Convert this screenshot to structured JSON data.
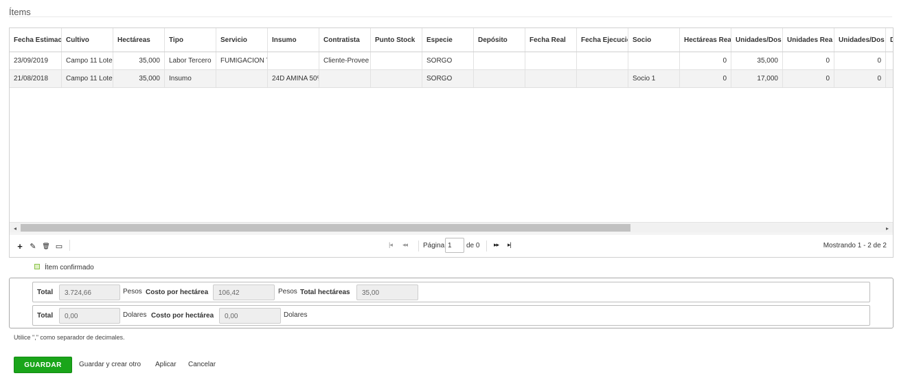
{
  "section": {
    "title": "Ítems"
  },
  "grid": {
    "columns": [
      {
        "label": "Fecha Estimac"
      },
      {
        "label": "Cultivo"
      },
      {
        "label": "Hectáreas"
      },
      {
        "label": "Tipo"
      },
      {
        "label": "Servicio"
      },
      {
        "label": "Insumo"
      },
      {
        "label": "Contratista"
      },
      {
        "label": "Punto Stock"
      },
      {
        "label": "Especie"
      },
      {
        "label": "Depósito"
      },
      {
        "label": "Fecha Real"
      },
      {
        "label": "Fecha Ejecució"
      },
      {
        "label": "Socio"
      },
      {
        "label": "Hectáreas Rea"
      },
      {
        "label": "Unidades/Dos"
      },
      {
        "label": "Unidades Rea"
      },
      {
        "label": "Unidades/Dos"
      },
      {
        "label": "D"
      }
    ],
    "rows": [
      {
        "cells": [
          "23/09/2019",
          "Campo 11 Lote",
          "35,000",
          "Labor Tercero",
          "FUMIGACION T",
          "",
          "Cliente-Provee",
          "",
          "SORGO",
          "",
          "",
          "",
          "",
          "0",
          "35,000",
          "0",
          "0",
          ""
        ]
      },
      {
        "cells": [
          "21/08/2018",
          "Campo 11 Lote",
          "35,000",
          "Insumo",
          "",
          "24D AMINA 50%",
          "",
          "",
          "SORGO",
          "",
          "",
          "",
          "Socio 1",
          "0",
          "17,000",
          "0",
          "0",
          ""
        ]
      }
    ]
  },
  "scrollbar": {
    "left_arrow": "◂",
    "right_arrow": "▸"
  },
  "toolbar": {
    "add_icon": "+",
    "edit_icon": "✎",
    "delete_icon": "🗑",
    "view_icon": "▭"
  },
  "pager": {
    "first_icon": "|◂",
    "prev_icon": "◂◂",
    "page_label": "Página",
    "page_value": "1",
    "of_label": "de 0",
    "next_icon": "▸▸",
    "last_icon": "▸|",
    "info": "Mostrando 1 - 2 de 2"
  },
  "legend": {
    "label": "Ítem confirmado",
    "swatch_color": "#dff0c5"
  },
  "totals": {
    "pesos": {
      "total_label": "Total",
      "total_value": "3.724,66",
      "unit1": "Pesos",
      "cost_label": "Costo por hectárea",
      "cost_value": "106,42",
      "unit2": "Pesos",
      "hect_label": "Total hectáreas",
      "hect_value": "35,00"
    },
    "dolares": {
      "total_label": "Total",
      "total_value": "0,00",
      "unit1": "Dolares",
      "cost_label": "Costo por hectárea",
      "cost_value": "0,00",
      "unit2": "Dolares"
    }
  },
  "hint": "Utilice \",\" como separador de decimales.",
  "actions": {
    "save": "GUARDAR",
    "save_new": "Guardar y crear otro",
    "apply": "Aplicar",
    "cancel": "Cancelar"
  },
  "colors": {
    "save_button": "#1aa51a",
    "row_alt": "#f3f3f3"
  }
}
